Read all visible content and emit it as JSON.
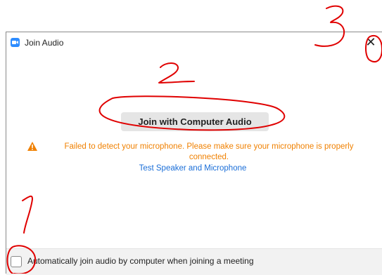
{
  "window": {
    "title": "Join Audio"
  },
  "main": {
    "join_button_label": "Join with Computer Audio",
    "warning_text": "Failed to detect your microphone. Please make sure your microphone is properly connected.",
    "test_link_label": "Test Speaker and Microphone"
  },
  "footer": {
    "auto_join_label": "Automatically join audio by computer when joining a meeting",
    "auto_join_checked": false
  },
  "annotations": {
    "numbers": [
      "1",
      "2",
      "3"
    ],
    "color": "#e00000"
  },
  "colors": {
    "warning": "#f08000",
    "link": "#1a6ed8",
    "brand": "#2d8cff"
  }
}
